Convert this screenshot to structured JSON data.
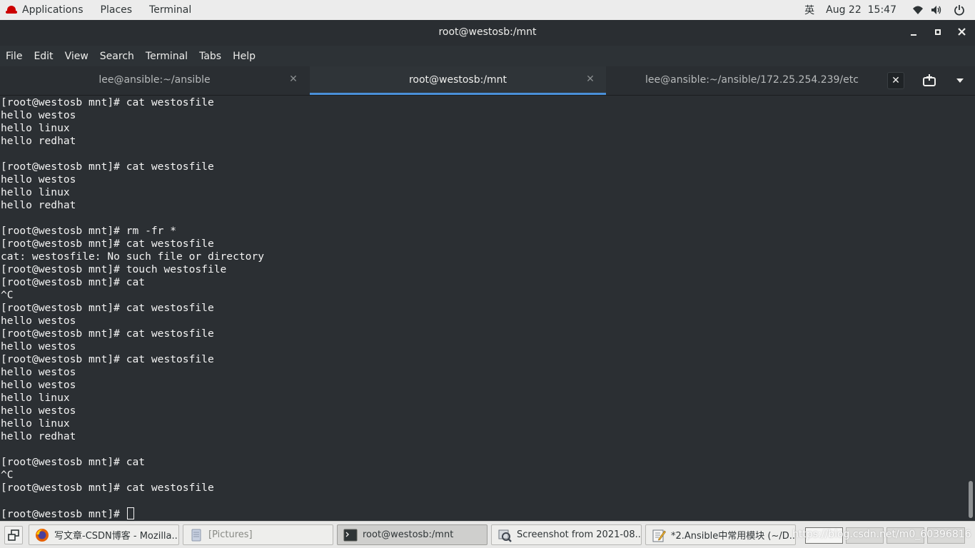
{
  "topbar": {
    "applications": "Applications",
    "places": "Places",
    "app_name": "Terminal",
    "input_method": "英",
    "datetime": "Aug 22  15:47"
  },
  "window": {
    "title": "root@westosb:/mnt"
  },
  "menubar": [
    "File",
    "Edit",
    "View",
    "Search",
    "Terminal",
    "Tabs",
    "Help"
  ],
  "tabs": [
    {
      "label": "lee@ansible:~/ansible"
    },
    {
      "label": "root@westosb:/mnt"
    },
    {
      "label": "lee@ansible:~/ansible/172.25.254.239/etc"
    }
  ],
  "terminal": {
    "lines": [
      "[root@westosb mnt]# cat westosfile",
      "hello westos",
      "hello linux",
      "hello redhat",
      "",
      "[root@westosb mnt]# cat westosfile",
      "hello westos",
      "hello linux",
      "hello redhat",
      "",
      "[root@westosb mnt]# rm -fr *",
      "[root@westosb mnt]# cat westosfile",
      "cat: westosfile: No such file or directory",
      "[root@westosb mnt]# touch westosfile",
      "[root@westosb mnt]# cat",
      "^C",
      "[root@westosb mnt]# cat westosfile",
      "hello westos",
      "[root@westosb mnt]# cat westosfile",
      "hello westos",
      "[root@westosb mnt]# cat westosfile",
      "hello westos",
      "hello westos",
      "hello linux",
      "hello westos",
      "hello linux",
      "hello redhat",
      "",
      "[root@westosb mnt]# cat",
      "^C",
      "[root@westosb mnt]# cat westosfile",
      ""
    ],
    "prompt": "[root@westosb mnt]# "
  },
  "taskbar": {
    "items": [
      {
        "label": "写文章-CSDN博客 - Mozilla...",
        "icon": "firefox-icon"
      },
      {
        "label": "[Pictures]",
        "icon": "folder-icon"
      },
      {
        "label": "root@westosb:/mnt",
        "icon": "terminal-icon"
      },
      {
        "label": "Screenshot from 2021-08...",
        "icon": "image-viewer-icon"
      },
      {
        "label": "*2.Ansible中常用模块 (~/D...",
        "icon": "text-editor-icon"
      }
    ],
    "watermark": "https://blog.csdn.net/m0_60396816"
  },
  "colors": {
    "terminal_bg": "#2b2f33",
    "terminal_fg": "#f3f3f3",
    "tab_accent": "#4a90d9"
  }
}
